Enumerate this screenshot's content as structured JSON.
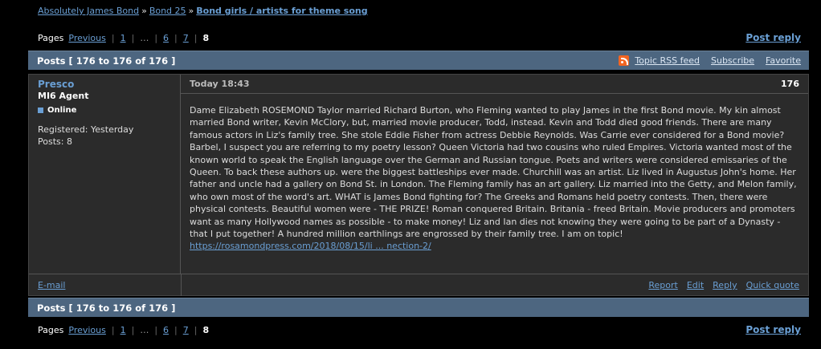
{
  "breadcrumbs": {
    "items": [
      "Absolutely James Bond",
      "Bond 25",
      "Bond girls / artists for theme song"
    ],
    "separator": "»"
  },
  "pagination": {
    "label": "Pages",
    "previous": "Previous",
    "pages": [
      "1",
      "…",
      "6",
      "7"
    ],
    "current": "8",
    "post_reply": "Post reply"
  },
  "topic_header": {
    "title": "Posts [ 176 to 176 of 176 ]",
    "rss_link": "Topic RSS feed",
    "subscribe": "Subscribe",
    "favorite": "Favorite",
    "rss_icon": "rss-icon"
  },
  "post": {
    "author": "Presco",
    "user_title": "MI6 Agent",
    "status": "Online",
    "registered": "Registered: Yesterday",
    "posts_count": "Posts: 8",
    "date": "Today 18:43",
    "number": "176",
    "text": "Dame Elizabeth ROSEMOND Taylor married Richard Burton, who Fleming wanted to play James in the first Bond movie. My kin almost married Bond writer, Kevin McClory, but, married movie producer, Todd, instead. Kevin and Todd died good friends. There are many famous actors in Liz's family tree. She stole Eddie Fisher from actress Debbie Reynolds. Was Carrie ever considered for a Bond movie? Barbel, I suspect you are referring to my poetry lesson? Queen Victoria had two cousins who ruled Empires. Victoria wanted most of the known world to speak the English language over the German and Russian tongue. Poets and writers were considered emissaries of the Queen. To back these authors up. were the biggest battleships ever made. Churchill was an artist. Liz lived in Augustus John's home. Her father and uncle had a gallery on Bond St. in London. The Fleming family has an art gallery. Liz married into the Getty, and Melon family, who own most of the word's art. WHAT is James Bond fighting for? The Greeks and Romans held poetry contests. Then, there were physical contests. Beautiful women were - THE PRIZE! Roman conquered Britain. Britania - freed Britain. Movie producers and promoters want as many Hollywood names as possible - to make money! Liz and Ian dies not knowing they were going to be part of a Dynasty - that I put together! A hundred million earthlings are engrossed by their family tree. I am on topic! ",
    "link_text": "https://rosamondpress.com/2018/08/15/li ... nection-2/",
    "email": "E-mail",
    "actions": [
      "Report",
      "Edit",
      "Reply",
      "Quick quote"
    ]
  },
  "colors": {
    "header_bg": "#4d6680",
    "post_bg": "#2b2b2b",
    "link": "#6a9fd4"
  }
}
